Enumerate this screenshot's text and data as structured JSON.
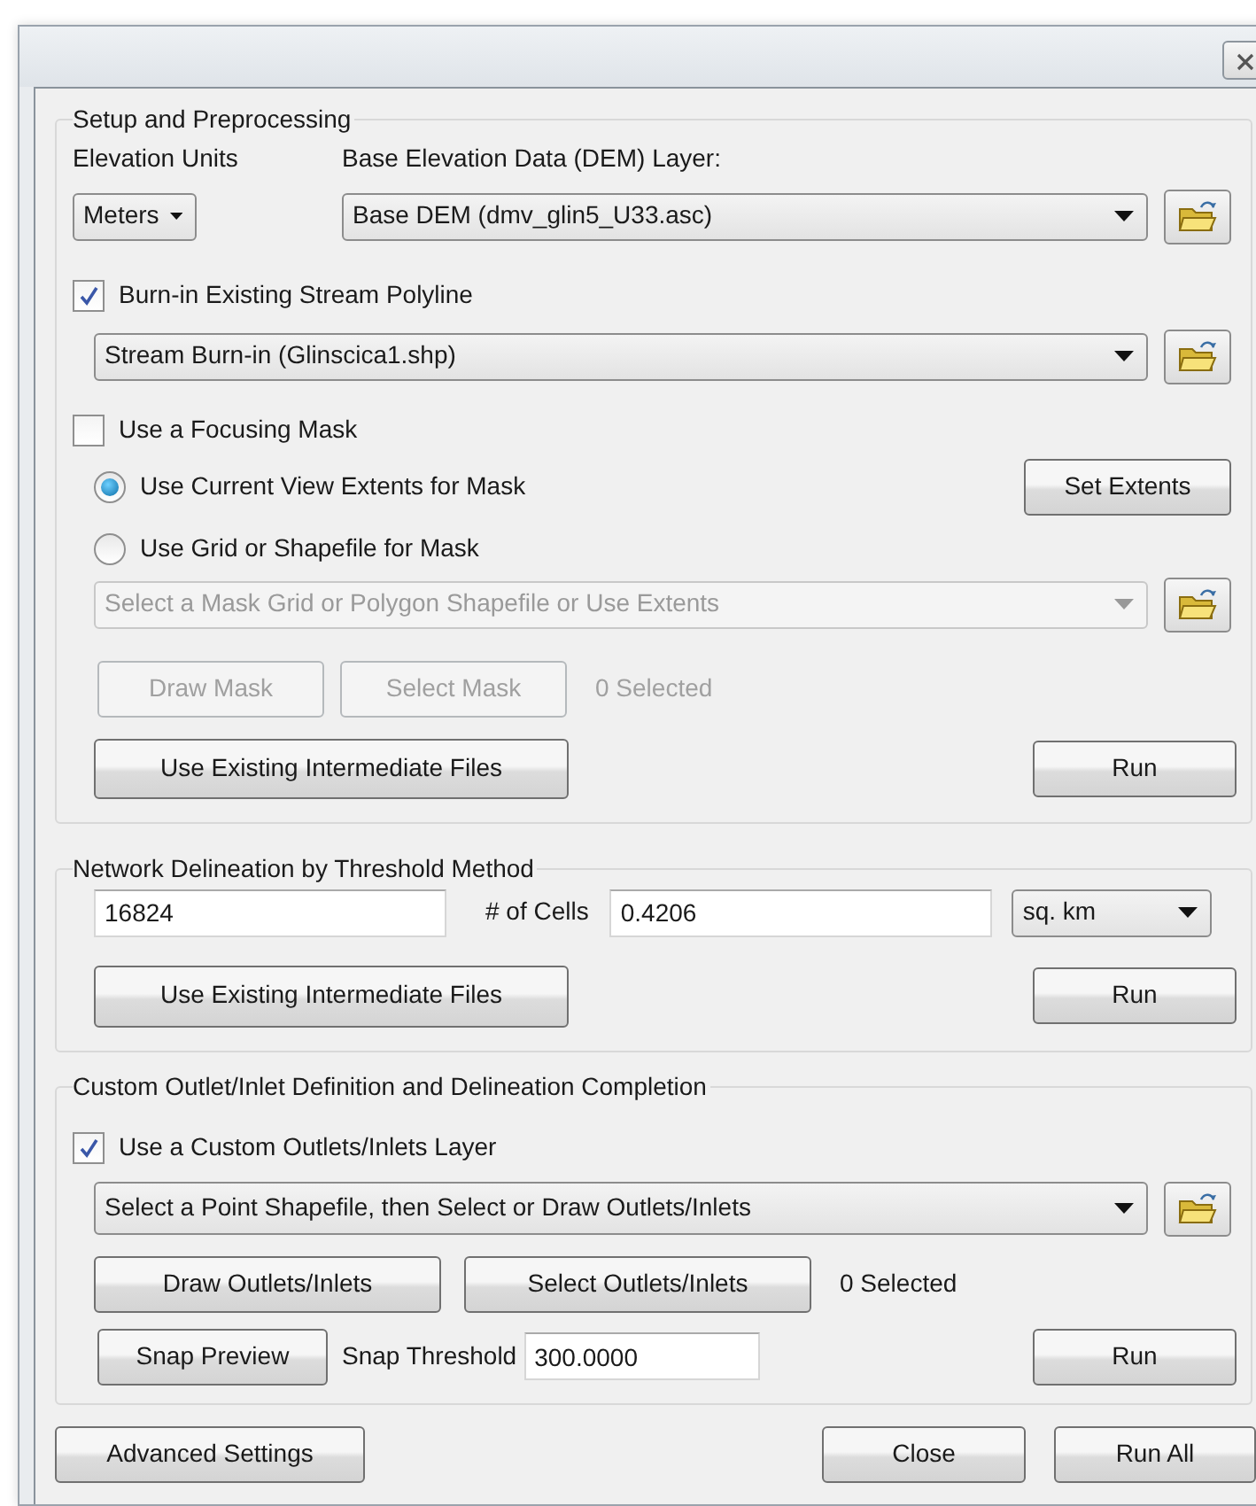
{
  "setup": {
    "title": "Setup and Preprocessing",
    "elevation_units_label": "Elevation Units",
    "dem_layer_label": "Base Elevation Data (DEM) Layer:",
    "elevation_units": {
      "value": "Meters"
    },
    "dem_layer": {
      "value": "Base DEM (dmv_glin5_U33.asc)"
    },
    "burn_in": {
      "label": "Burn-in Existing Stream Polyline",
      "checked": true
    },
    "stream_layer": {
      "value": "Stream Burn-in (Glinscica1.shp)"
    },
    "focusing_mask": {
      "label": "Use a Focusing Mask",
      "checked": false
    },
    "mask_options": [
      {
        "label": "Use Current View Extents for Mask",
        "selected": true
      },
      {
        "label": "Use Grid or Shapefile for Mask",
        "selected": false
      }
    ],
    "set_extents_button": "Set Extents",
    "mask_layer": {
      "value": "Select a Mask Grid or Polygon Shapefile or Use Extents",
      "disabled": true
    },
    "mask_buttons": [
      {
        "label": "Draw Mask",
        "disabled": true
      },
      {
        "label": "Select Mask",
        "disabled": true
      }
    ],
    "mask_selected": {
      "text": "0 Selected",
      "disabled": true
    },
    "intermediate_button": "Use Existing Intermediate Files",
    "run_button": "Run"
  },
  "network": {
    "title": "Network Delineation by Threshold Method",
    "cells_value": "16824",
    "cells_label": "# of Cells",
    "area_value": "0.4206",
    "area_unit": {
      "value": "sq. km"
    },
    "intermediate_button": "Use Existing Intermediate Files",
    "run_button": "Run"
  },
  "outlets": {
    "title": "Custom Outlet/Inlet Definition and Delineation Completion",
    "custom_layer": {
      "label": "Use a Custom Outlets/Inlets Layer",
      "checked": true
    },
    "point_layer": {
      "value": "Select a Point Shapefile, then Select or Draw Outlets/Inlets"
    },
    "buttons": [
      {
        "label": "Draw Outlets/Inlets",
        "disabled": false
      },
      {
        "label": "Select Outlets/Inlets",
        "disabled": false
      }
    ],
    "selected_count": "0 Selected",
    "snap_preview_button": "Snap Preview",
    "snap_threshold_label": "Snap Threshold",
    "snap_threshold_value": "300.0000",
    "run_button": "Run"
  },
  "footer": {
    "advanced_button": "Advanced Settings",
    "close_button": "Close",
    "run_all_button": "Run All"
  }
}
